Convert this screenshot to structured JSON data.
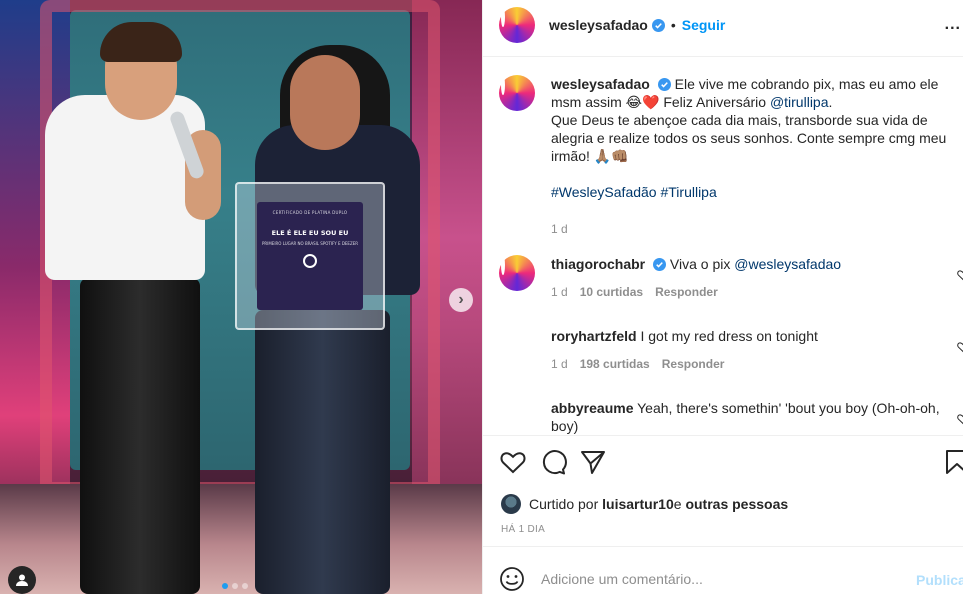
{
  "post": {
    "username": "wesleysafadao",
    "follow_label": "Seguir",
    "bullet": "•",
    "more_label": "...",
    "caption": {
      "username": "wesleysafadao",
      "line1": " Ele vive me cobrando pix, mas eu amo ele msm assim 😂❤️ Feliz Aniversário ",
      "mention": "@tirullipa",
      "line1_end": ".",
      "line2": "Que Deus te abençoe cada dia mais, transborde sua vida de alegria e realize todos os seus sonhos. Conte sempre cmg meu irmão! 🙏🏽👊🏽",
      "hashtags": "#WesleySafadão #Tirullipa",
      "time": "1 d"
    },
    "comments": [
      {
        "username": "thiagorochabr",
        "verified": true,
        "text": "Viva o pix ",
        "mention": "@wesleysafadao",
        "time": "1 d",
        "likes": "10 curtidas",
        "reply": "Responder"
      },
      {
        "username": "roryhartzfeld",
        "verified": false,
        "text": "I got my red dress on tonight",
        "mention": "",
        "time": "1 d",
        "likes": "198 curtidas",
        "reply": "Responder"
      },
      {
        "username": "abbyreaume",
        "verified": false,
        "text": "Yeah, there's somethin' 'bout you boy (Oh-oh-oh, boy)",
        "mention": "",
        "time": "",
        "likes": "",
        "reply": ""
      }
    ],
    "liked_by": {
      "prefix": "Curtido por ",
      "user": "luisartur10",
      "middle": " e ",
      "others": "outras pessoas"
    },
    "ago": "HÁ 1 DIA",
    "comment_placeholder": "Adicione um comentário...",
    "publish_label": "Publicar"
  },
  "image": {
    "plaque_top": "CERTIFICADO DE PLATINA DUPLO",
    "plaque_main": "ELE É ELE EU SOU EU",
    "plaque_sub": "PRIMEIRO LUGAR NO BRASIL SPOTIFY E DEEZER",
    "carousel_count": 3,
    "carousel_active": 0
  },
  "colors": {
    "accent": "#0095f6",
    "verified": "#3897f0",
    "link": "#00376b",
    "muted": "#8e8e8e",
    "text": "#262626"
  },
  "icons": [
    "more-icon",
    "verified-icon",
    "heart-icon",
    "comment-icon",
    "share-icon",
    "bookmark-icon",
    "emoji-icon",
    "user-tag-icon",
    "chevron-right-icon"
  ]
}
